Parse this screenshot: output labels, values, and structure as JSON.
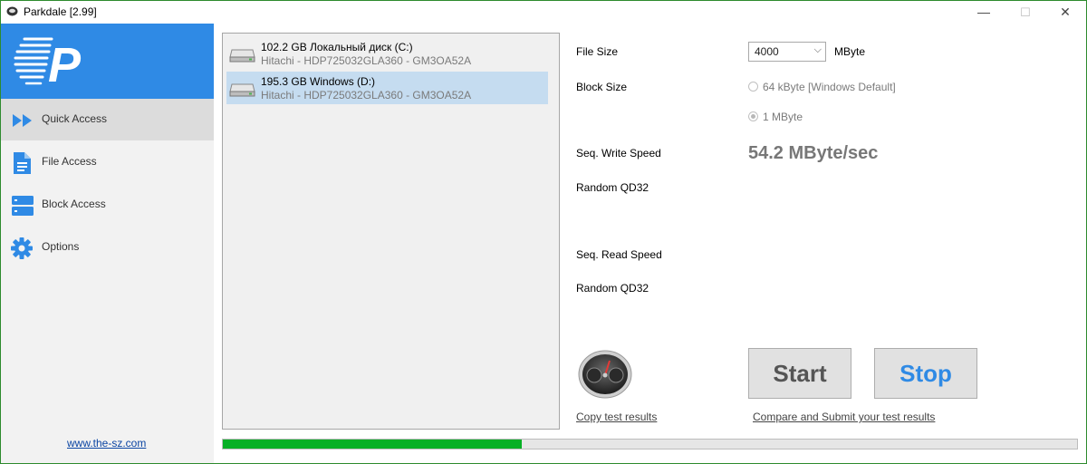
{
  "window": {
    "title": "Parkdale [2.99]",
    "controls": {
      "minimize": "—",
      "maximize": "☐",
      "close": "✕"
    }
  },
  "colors": {
    "accent": "#2f8ae5",
    "progress": "#06b025",
    "selection": "#c5dcf0"
  },
  "sidebar": {
    "logo_letter": "P",
    "items": [
      {
        "label": "Quick Access",
        "icon": "fast-forward-icon",
        "active": true
      },
      {
        "label": "File Access",
        "icon": "document-icon",
        "active": false
      },
      {
        "label": "Block Access",
        "icon": "server-icon",
        "active": false
      },
      {
        "label": "Options",
        "icon": "gear-icon",
        "active": false
      }
    ],
    "website": "www.the-sz.com"
  },
  "drives": [
    {
      "name": "102.2 GB Локальный диск (C:)",
      "model": "Hitachi - HDP725032GLA360 - GM3OA52A",
      "selected": false,
      "icon": "hard-drive-icon"
    },
    {
      "name": "195.3 GB Windows (D:)",
      "model": "Hitachi - HDP725032GLA360 - GM3OA52A",
      "selected": true,
      "icon": "hard-drive-icon"
    }
  ],
  "settings": {
    "file_size_label": "File Size",
    "file_size_value": "4000",
    "file_size_unit": "MByte",
    "block_size_label": "Block Size",
    "block_size_options": [
      {
        "label": "64 kByte [Windows Default]",
        "checked": false
      },
      {
        "label": "1 MByte",
        "checked": true
      }
    ]
  },
  "results": {
    "seq_write_label": "Seq. Write Speed",
    "seq_write_value": "54.2 MByte/sec",
    "random_write_label": "Random QD32",
    "seq_read_label": "Seq. Read Speed",
    "random_read_label": "Random QD32"
  },
  "actions": {
    "start_label": "Start",
    "stop_label": "Stop",
    "copy_link": "Copy test results",
    "compare_link": "Compare and Submit your test results",
    "gauge_icon": "speedometer-icon"
  },
  "progress": {
    "value": 0.35
  }
}
